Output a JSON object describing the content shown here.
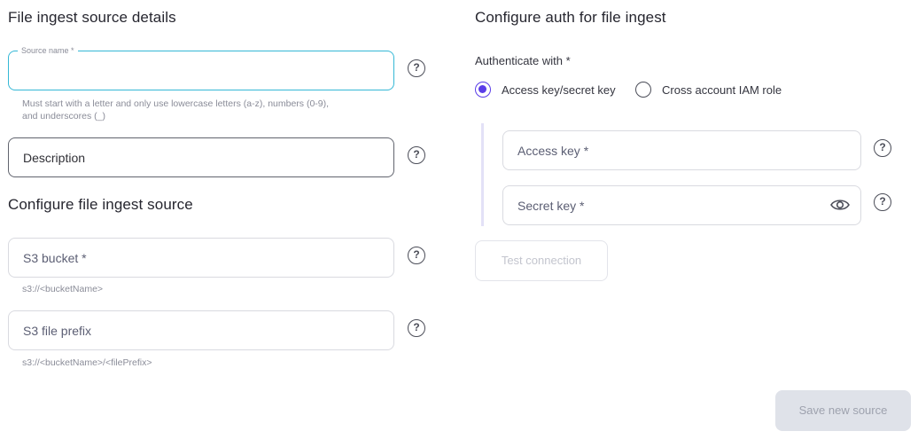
{
  "left": {
    "details_heading": "File ingest source details",
    "source_name_label": "Source name *",
    "source_name_value": "",
    "source_name_hint_1": "Must start with a letter and only use lowercase letters (a-z), numbers (0-9),",
    "source_name_hint_2": "and underscores (_)",
    "description_placeholder": "Description",
    "configure_heading": "Configure file ingest source",
    "bucket_placeholder": "S3 bucket *",
    "bucket_hint": "s3://<bucketName>",
    "prefix_placeholder": "S3 file prefix",
    "prefix_hint": "s3://<bucketName>/<filePrefix>"
  },
  "right": {
    "auth_heading": "Configure auth for file ingest",
    "authenticate_label": "Authenticate with *",
    "options": [
      {
        "label": "Access key/secret key",
        "selected": true
      },
      {
        "label": "Cross account IAM role",
        "selected": false
      }
    ],
    "access_key_placeholder": "Access key *",
    "secret_key_placeholder": "Secret key *",
    "test_connection_label": "Test connection"
  },
  "footer": {
    "save_label": "Save new source"
  },
  "icons": {
    "help": "question-circle-icon",
    "eye": "eye-icon"
  },
  "colors": {
    "accent": "#5a3de8",
    "focus_border": "#35b8d6",
    "disabled_bg": "#dfe2e9"
  }
}
